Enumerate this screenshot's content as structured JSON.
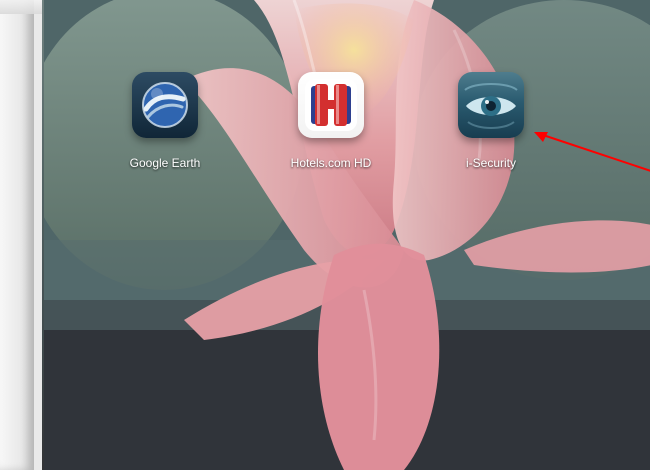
{
  "apps": [
    {
      "label": "Google Earth",
      "icon": "google-earth-icon",
      "colors": {
        "primary": "#1f4f8a",
        "accent": "#c7d8e6"
      }
    },
    {
      "label": "Hotels.com HD",
      "icon": "hotels-com-icon",
      "colors": {
        "primary": "#d32f2f",
        "accent": "#2b3c8f"
      }
    },
    {
      "label": "i-Security",
      "icon": "eye-icon",
      "colors": {
        "primary": "#2a5b70",
        "accent": "#7fb0c2"
      }
    }
  ],
  "annotation": {
    "color": "#ff0000"
  }
}
